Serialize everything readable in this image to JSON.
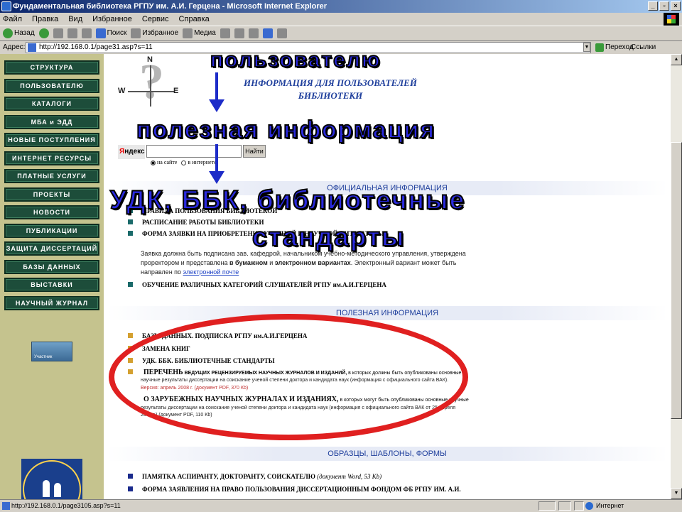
{
  "window": {
    "title": "Фундаментальная библиотека РГПУ им. А.И. Герцена - Microsoft Internet Explorer",
    "min_glyph": "_",
    "max_glyph": "▫",
    "close_glyph": "×"
  },
  "menu": [
    "Файл",
    "Правка",
    "Вид",
    "Избранное",
    "Сервис",
    "Справка"
  ],
  "toolbar": {
    "back": "Назад",
    "search": "Поиск",
    "favorites": "Избранное",
    "media": "Медиа"
  },
  "address": {
    "label": "Адрес:",
    "url": "http://192.168.0.1/page31.asp?s=11",
    "dropdown_glyph": "▼",
    "go": "Переход",
    "links": "Ссылки"
  },
  "sidebar": {
    "items": [
      "СТРУКТУРА",
      "ПОЛЬЗОВАТЕЛЮ",
      "КАТАЛОГИ",
      "МБА и ЭДД",
      "НОВЫЕ ПОСТУПЛЕНИЯ",
      "ИНТЕРНЕТ РЕСУРСЫ",
      "ПЛАТНЫЕ УСЛУГИ",
      "ПРОЕКТЫ",
      "НОВОСТИ",
      "ПУБЛИКАЦИИ",
      "ЗАЩИТА ДИССЕРТАЦИЙ",
      "БАЗЫ ДАННЫХ",
      "ВЫСТАВКИ",
      "НАУЧНЫЙ ЖУРНАЛ"
    ],
    "participant_label": "Участник"
  },
  "compass": {
    "q": "?",
    "n": "N",
    "w": "W",
    "e": "E"
  },
  "header_title": {
    "line1": "ИНФОРМАЦИЯ ДЛЯ ПОЛЬЗОВАТЕЛЕЙ",
    "line2": "БИБЛИОТЕКИ"
  },
  "yandex": {
    "logo_y": "Я",
    "logo_rest": "ндекс",
    "search_button": "Найти",
    "option_site": "на сайте",
    "option_internet": "в интернете"
  },
  "sections": {
    "official": "ОФИЦИАЛЬНАЯ ИНФОРМАЦИЯ",
    "useful": "ПОЛЕЗНАЯ ИНФОРМАЦИЯ",
    "samples": "ОБРАЗЦЫ, ШАБЛОНЫ, ФОРМЫ"
  },
  "official_items": [
    "ПРАВИЛА ПОЛЬЗОВАНИЯ БИБЛИОТЕКОЙ",
    "РАСПИСАНИЕ РАБОТЫ БИБЛИОТЕКИ",
    "ФОРМА ЗАЯВКИ НА ПРИОБРЕТЕНИЕ УЧЕБНОЙ И НАУЧНОЙ ЛИТЕРАТУРЫ"
  ],
  "order_note": {
    "line1": "Заявка должна быть подписана зав. кафедрой, начальником учебно-методического управления, утверждена",
    "line2_a": "проректором и представлена ",
    "line2_b": "в бумажном",
    "line2_c": " и ",
    "line2_d": "электронном вариантах",
    "line2_e": ". Электронный вариант может быть",
    "line3_a": "направлен по ",
    "line3_link": "электронной почте"
  },
  "official_last": "ОБУЧЕНИЕ РАЗЛИЧНЫХ КАТЕГОРИЙ СЛУШАТЕЛЕЙ РГПУ им.А.И.ГЕРЦЕНА",
  "useful_items": [
    "БАЗЫ ДАННЫХ. ПОДПИСКА РГПУ им.А.И.ГЕРЦЕНА",
    "ЗАМЕНА КНИГ",
    "УДК. ББК. БИБЛИОТЕЧНЫЕ СТАНДАРТЫ"
  ],
  "list_vak": {
    "title_a": "ПЕРЕЧЕНЬ",
    "title_b": " ВЕДУЩИХ РЕЦЕНЗИРУЕМЫХ НАУЧНЫХ ЖУРНАЛОВ И ИЗДАНИЙ,",
    "title_c": " в    которых должны быть опубликованы основные",
    "line2": "научные результаты диссертации на соискание ученой степени доктора и кандидата наук (информация с официального сайта ВАК).",
    "version": "Версия: апрель 2008 г. (документ PDF, 370 Кb)"
  },
  "list_foreign": {
    "title_a": "О ЗАРУБЕЖНЫХ НАУЧНЫХ ЖУРНАЛАХ И ИЗДАНИЯХ,",
    "title_b": " в    которых могут быть опубликованы основные научные",
    "line2": "результаты диссертации на соискание ученой степени доктора и кандидата наук (информация с официального сайта ВАК от 25 апреля",
    "line3": "2008 г.) (документ PDF, 110 Кb)"
  },
  "samples_items": [
    "ПАМЯТКА АСПИРАНТУ, ДОКТОРАНТУ, СОИСКАТЕЛЮ",
    "ФОРМА ЗАЯВЛЕНИЯ НА ПРАВО ПОЛЬЗОВАНИЯ ДИССЕРТАЦИОННЫМ    ФОНДОМ   ФБ РГПУ ИМ. А.И."
  ],
  "samples_note": "(документ Word, 53 Кb)",
  "overlays": {
    "user": "пользователю",
    "useful": "полезная информация",
    "udk1": "УДК, ББК, библиотечные",
    "udk2": "стандарты"
  },
  "status": {
    "url": "http://192.168.0.1/page3105.asp?s=11",
    "zone": "Интернет"
  },
  "scrollbar": {
    "up_glyph": "▲",
    "down_glyph": "▼"
  },
  "colors": {
    "nav_bg": "#1d4d3a",
    "sidebar_bg": "#c5c38e",
    "section_blue": "#1f3f9c",
    "overlay_blue": "#2a2adf",
    "ellipse_red": "#e02020",
    "bullet_teal": "#1a6a6a",
    "bullet_gold": "#d4a030",
    "bullet_navy": "#1a2a8c"
  }
}
